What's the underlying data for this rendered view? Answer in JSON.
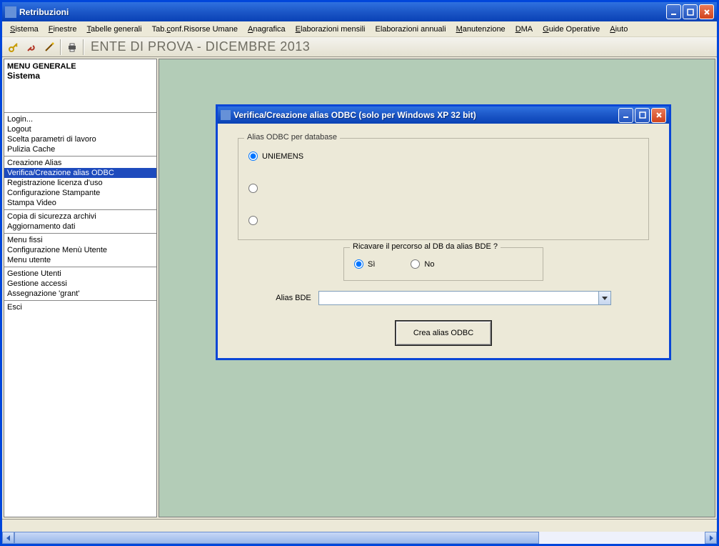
{
  "main": {
    "title": "Retribuzioni",
    "menus": [
      {
        "label": "Sistema",
        "u": 0
      },
      {
        "label": "Finestre",
        "u": 0
      },
      {
        "label": "Tabelle generali",
        "u": 0
      },
      {
        "label": "Tab.conf.Risorse Umane",
        "u": 4
      },
      {
        "label": "Anagrafica",
        "u": 0
      },
      {
        "label": "Elaborazioni mensili",
        "u": 0
      },
      {
        "label": "Elaborazioni annuali",
        "u": null
      },
      {
        "label": "Manutenzione",
        "u": 0
      },
      {
        "label": "DMA",
        "u": 0
      },
      {
        "label": "Guide Operative",
        "u": 0
      },
      {
        "label": "Aiuto",
        "u": 0
      }
    ],
    "context_label": "ENTE DI PROVA - DICEMBRE 2013"
  },
  "sidebar": {
    "title1": "MENU GENERALE",
    "title2": "Sistema",
    "groups": [
      [
        "Login...",
        "Logout",
        "Scelta parametri di lavoro",
        "Pulizia Cache"
      ],
      [
        "Creazione Alias",
        "Verifica/Creazione alias ODBC",
        "Registrazione licenza d'uso",
        "Configurazione Stampante",
        "Stampa Video"
      ],
      [
        "Copia di sicurezza archivi",
        "Aggiornamento dati"
      ],
      [
        "Menu fissi",
        "Configurazione Menù Utente",
        "Menu utente"
      ],
      [
        "Gestione Utenti",
        "Gestione accessi",
        "Assegnazione 'grant'"
      ],
      [
        "Esci"
      ]
    ],
    "selected": "Verifica/Creazione alias ODBC"
  },
  "dialog": {
    "title": "Verifica/Creazione alias ODBC (solo per Windows XP 32 bit)",
    "group1_legend": "Alias ODBC per database",
    "radio_db": [
      "UNIEMENS",
      "",
      ""
    ],
    "group2_legend": "Ricavare il percorso al DB da alias BDE ?",
    "yes": "Sì",
    "no": "No",
    "alias_label": "Alias BDE",
    "alias_value": "",
    "create_btn": "Crea alias ODBC"
  }
}
